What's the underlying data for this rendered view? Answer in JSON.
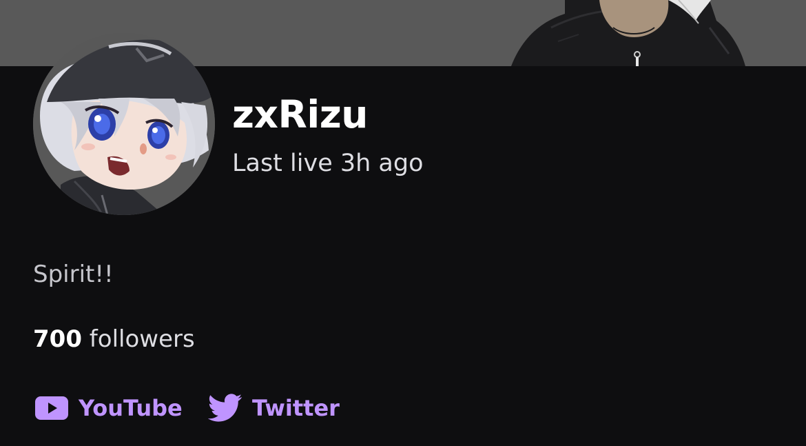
{
  "channel": {
    "name": "zxRizu",
    "last_live": "Last live 3h ago",
    "bio": "Spirit!!",
    "followers_count": "700",
    "followers_label": "followers"
  },
  "social_links": [
    {
      "label": "YouTube",
      "icon": "youtube-icon"
    },
    {
      "label": "Twitter",
      "icon": "twitter-icon"
    }
  ],
  "colors": {
    "background": "#0e0e10",
    "banner": "#595959",
    "link_accent": "#bf94ff",
    "text_primary": "#ffffff",
    "text_secondary": "#dedee3"
  }
}
